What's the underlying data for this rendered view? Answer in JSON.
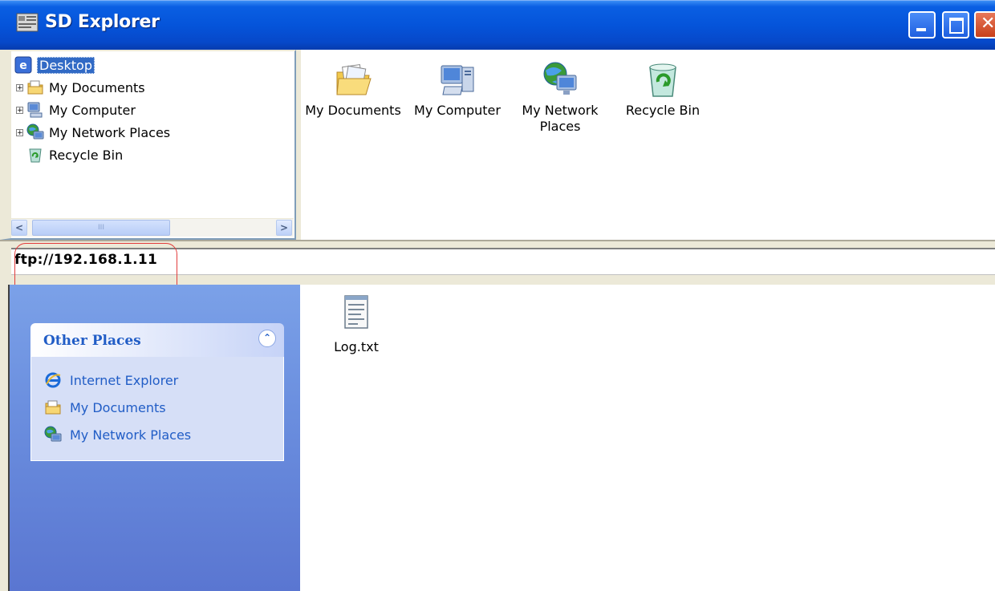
{
  "window": {
    "title": "SD Explorer",
    "icon": "sd-explorer-app-icon",
    "controls": {
      "minimize": "minimize-icon",
      "maximize": "maximize-icon",
      "close": "close-icon"
    }
  },
  "tree": {
    "items": [
      {
        "label": "Desktop",
        "icon": "desktop-icon",
        "expander": "",
        "selected": true
      },
      {
        "label": "My Documents",
        "icon": "my-documents-icon",
        "expander": "+"
      },
      {
        "label": "My Computer",
        "icon": "my-computer-icon",
        "expander": "+"
      },
      {
        "label": "My Network Places",
        "icon": "network-places-icon",
        "expander": "+"
      },
      {
        "label": "Recycle Bin",
        "icon": "recycle-bin-icon",
        "expander": ""
      }
    ],
    "scrollbar": {
      "left_arrow": "<",
      "thumb_grip": "III",
      "right_arrow": ">"
    }
  },
  "desktop_icons": [
    {
      "label": "My Documents",
      "icon": "my-documents-icon"
    },
    {
      "label": "My Computer",
      "icon": "my-computer-icon"
    },
    {
      "label": "My Network Places",
      "icon": "network-places-icon"
    },
    {
      "label": "Recycle Bin",
      "icon": "recycle-bin-icon"
    }
  ],
  "address": {
    "value": "ftp://192.168.1.11"
  },
  "other_places": {
    "title": "Other Places",
    "collapse_glyph": "⌃",
    "links": [
      {
        "label": "Internet Explorer",
        "icon": "internet-explorer-icon"
      },
      {
        "label": "My Documents",
        "icon": "my-documents-icon"
      },
      {
        "label": "My Network Places",
        "icon": "network-places-icon"
      }
    ]
  },
  "files": [
    {
      "label": "Log.txt",
      "icon": "text-file-icon"
    }
  ],
  "colors": {
    "titlebar_blue": "#0554da",
    "selection_blue": "#316ac5",
    "taskpane_blue": "#6b8fdf",
    "link_blue": "#215dc6",
    "highlight_red": "#e23c3c"
  }
}
